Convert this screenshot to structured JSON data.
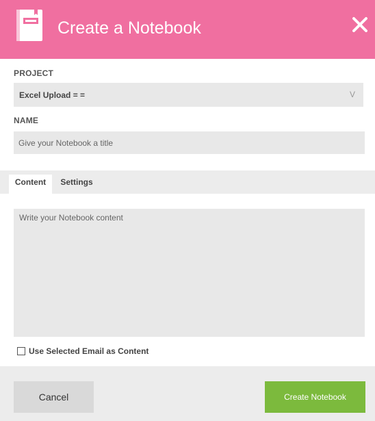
{
  "dialog": {
    "title": "Create a Notebook",
    "header_color": "#f06fa0",
    "header_icon": "notebook-icon",
    "close_icon": "close-icon"
  },
  "project": {
    "label": "PROJECT",
    "selected": "Excel Upload = =",
    "arrow": "V"
  },
  "name": {
    "label": "NAME",
    "placeholder": "Give your Notebook a title",
    "value": ""
  },
  "tabs": [
    {
      "label": "Content",
      "active": true
    },
    {
      "label": "Settings",
      "active": false
    }
  ],
  "content": {
    "placeholder": "Write your Notebook content",
    "value": ""
  },
  "option": {
    "label": "Use Selected Email as Content",
    "checked": false
  },
  "footer": {
    "cancel_label": "Cancel",
    "create_label": "Create Notebook",
    "create_color": "#7cba3d"
  }
}
